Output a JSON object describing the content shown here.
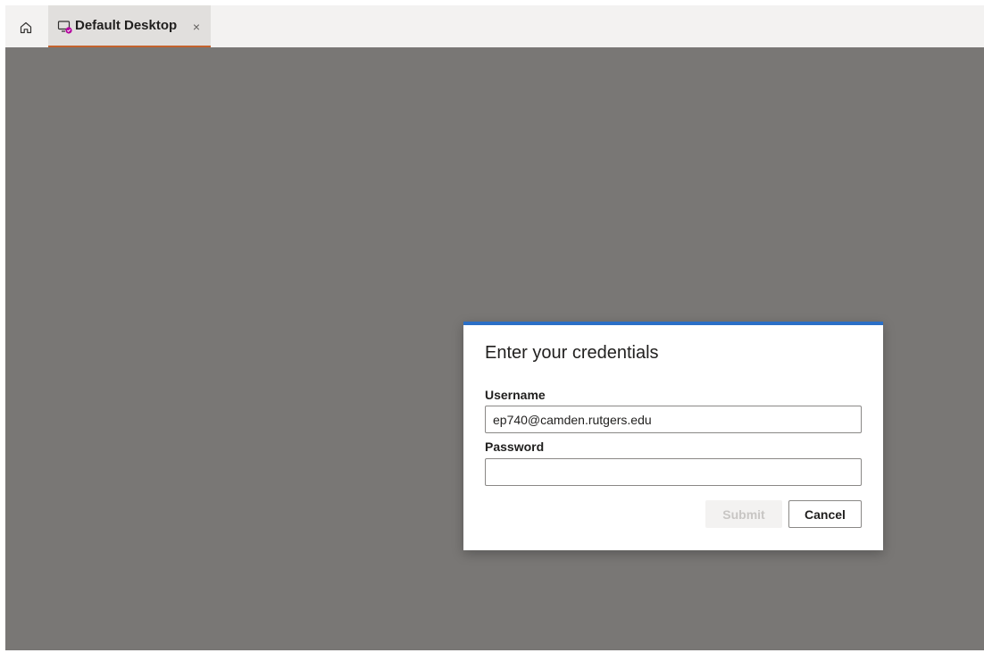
{
  "tabbar": {
    "home_icon": "home-icon",
    "tab": {
      "label": "Default Desktop",
      "icon": "remote-desktop-icon",
      "close_label": "×",
      "underline_color": "#c4622d"
    }
  },
  "dialog": {
    "title": "Enter your credentials",
    "accent_color": "#2b6fc6",
    "username": {
      "label": "Username",
      "value": "ep740@camden.rutgers.edu"
    },
    "password": {
      "label": "Password",
      "value": ""
    },
    "submit_label": "Submit",
    "cancel_label": "Cancel"
  }
}
